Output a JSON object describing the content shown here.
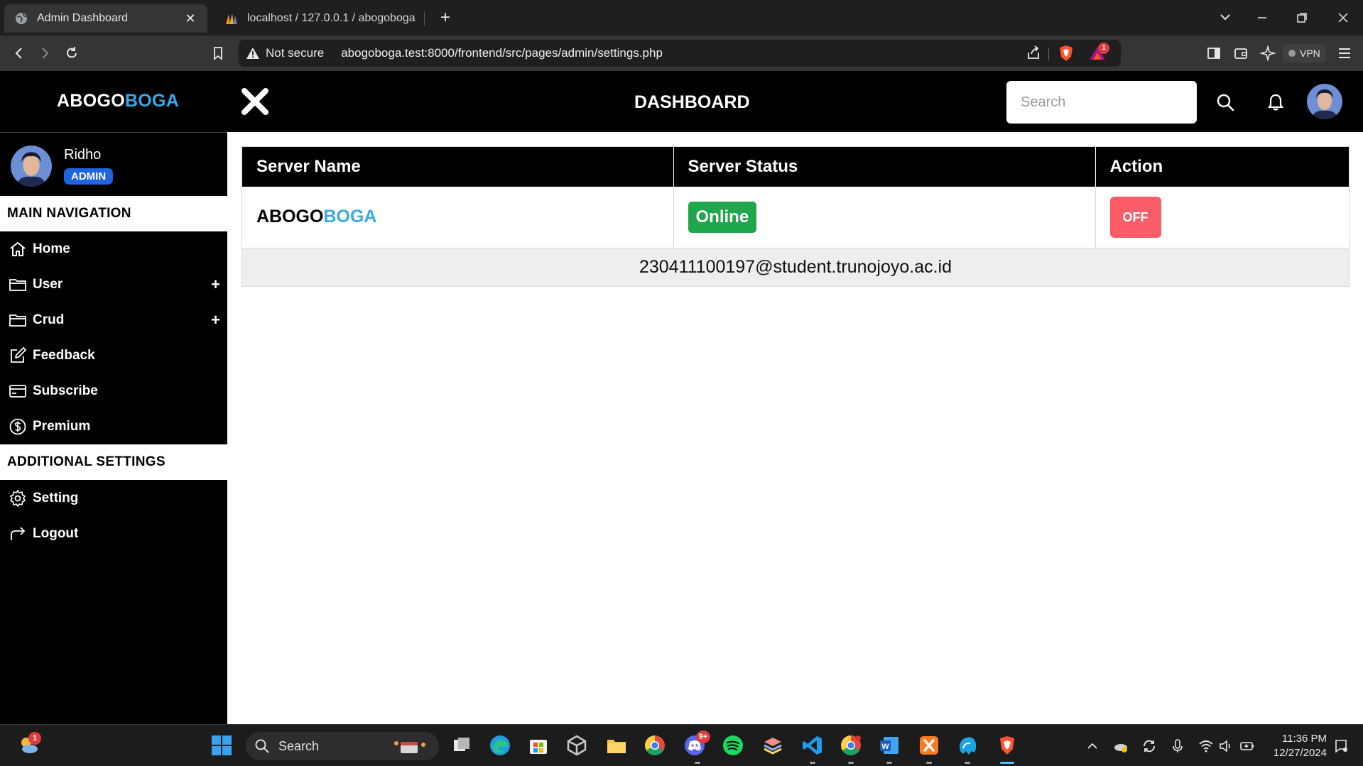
{
  "browser": {
    "tabs": [
      {
        "label": "Admin Dashboard",
        "close": "✕",
        "icon": "globe-icon",
        "active": true
      },
      {
        "label": "localhost / 127.0.0.1 / abogoboga /",
        "icon": "phpmyadmin-icon",
        "active": false
      }
    ],
    "new_tab": "+",
    "security_label": "Not secure",
    "url": "abogoboga.test:8000/frontend/src/pages/admin/settings.php",
    "vpn_label": "VPN",
    "rewards_badge": "1"
  },
  "header": {
    "logo_main": "ABOGO",
    "logo_accent": "BOGA",
    "title": "DASHBOARD",
    "search_placeholder": "Search"
  },
  "sidebar": {
    "user": {
      "name": "Ridho",
      "role": "ADMIN"
    },
    "main_section": "MAIN NAVIGATION",
    "main_items": [
      {
        "label": "Home",
        "icon": "home-icon",
        "expandable": false
      },
      {
        "label": "User",
        "icon": "folder-icon",
        "expandable": true
      },
      {
        "label": "Crud",
        "icon": "folder-icon",
        "expandable": true
      },
      {
        "label": "Feedback",
        "icon": "edit-icon",
        "expandable": false
      },
      {
        "label": "Subscribe",
        "icon": "card-icon",
        "expandable": false
      },
      {
        "label": "Premium",
        "icon": "dollar-icon",
        "expandable": false
      }
    ],
    "expand_symbol": "+",
    "additional_section": "ADDITIONAL SETTINGS",
    "additional_items": [
      {
        "label": "Setting",
        "icon": "gear-icon"
      },
      {
        "label": "Logout",
        "icon": "logout-icon"
      }
    ]
  },
  "table": {
    "headers": [
      "Server Name",
      "Server Status",
      "Action"
    ],
    "row": {
      "name_main": "ABOGO",
      "name_accent": "BOGA",
      "status": "Online",
      "action": "OFF"
    },
    "footer": "230411100197@student.trunojoyo.ac.id"
  },
  "taskbar": {
    "search_label": "Search",
    "weather_badge": "1",
    "discord_badge": "9+",
    "time": "11:36 PM",
    "date": "12/27/2024"
  },
  "colors": {
    "accent_blue": "#3aa9e8",
    "status_green": "#1ea84b",
    "off_red": "#fa5c68",
    "role_blue": "#1e63e0"
  }
}
